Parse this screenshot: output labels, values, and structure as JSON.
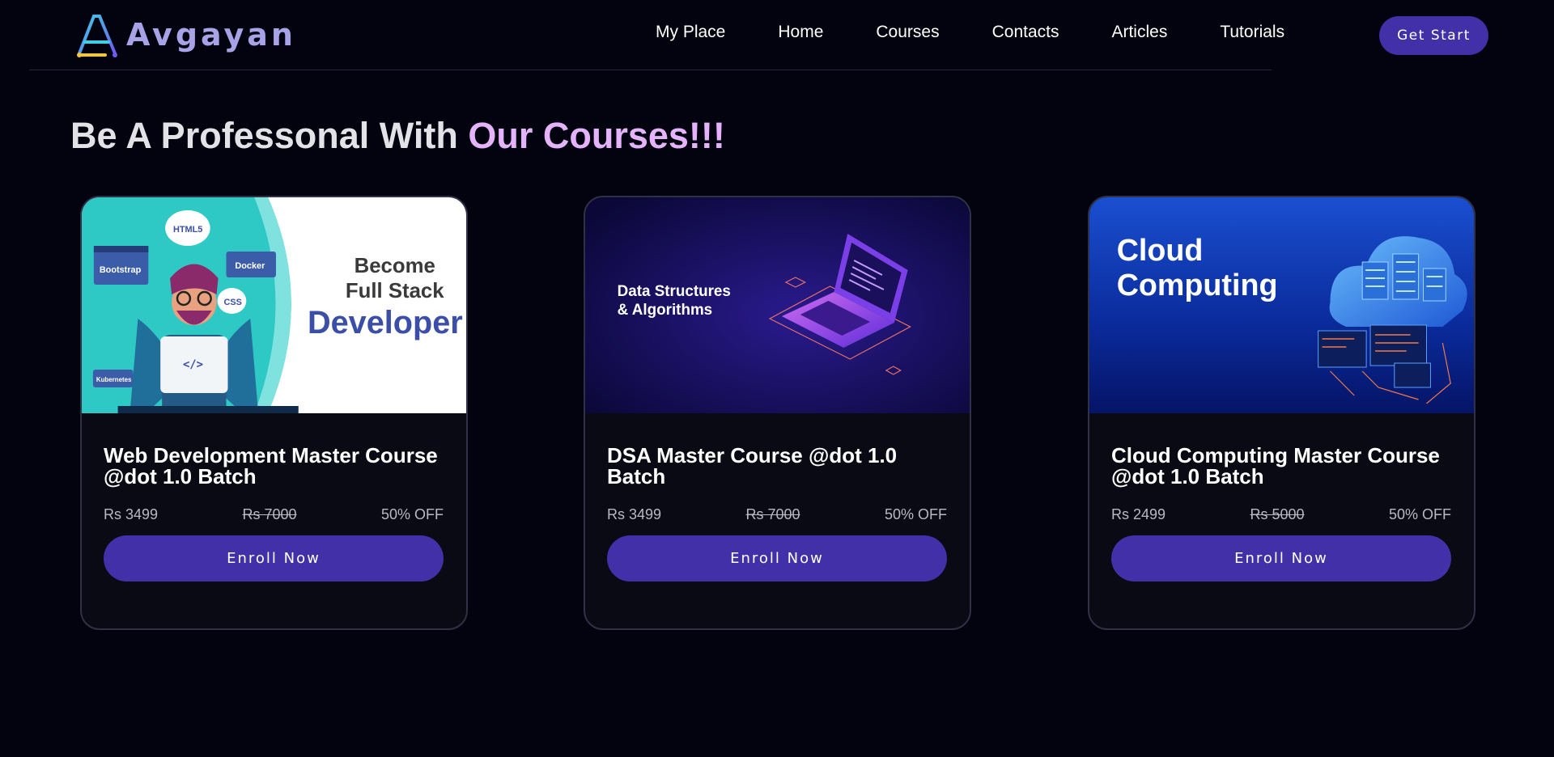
{
  "brand": {
    "name": "Avgayan"
  },
  "nav": {
    "links": [
      "My Place",
      "Home",
      "Courses",
      "Contacts",
      "Articles",
      "Tutorials"
    ],
    "cta_label": "Get Start"
  },
  "hero": {
    "headline_prefix": "Be A Professonal With ",
    "headline_accent": "Our Courses!!!"
  },
  "courses": [
    {
      "title": "Web Development Master Course @dot 1.0 Batch",
      "price": "Rs 3499",
      "original_price": "Rs 7000",
      "discount": "50% OFF",
      "enroll_label": "Enroll Now",
      "banner": {
        "line1": "Become",
        "line2": "Full Stack",
        "line3": "Developer",
        "tags": [
          "HTML5",
          "Bootstrap",
          "Docker",
          "CSS",
          "Kubernetes"
        ],
        "code_symbol": "</>"
      }
    },
    {
      "title": "DSA Master Course @dot 1.0 Batch",
      "price": "Rs 3499",
      "original_price": "Rs 7000",
      "discount": "50% OFF",
      "enroll_label": "Enroll Now",
      "banner": {
        "line1": "Data Structures",
        "line2": "& Algorithms"
      }
    },
    {
      "title": "Cloud Computing Master Course @dot 1.0 Batch",
      "price": "Rs 2499",
      "original_price": "Rs 5000",
      "discount": "50% OFF",
      "enroll_label": "Enroll Now",
      "banner": {
        "line1": "Cloud",
        "line2": "Computing"
      }
    }
  ],
  "colors": {
    "background": "#03030f",
    "accent": "#4130a7",
    "headline_accent": "#e5b3fb",
    "card_border": "#303046"
  },
  "icons": {
    "logo": "a-monogram-logo-icon",
    "code": "code-brackets-icon",
    "laptop": "laptop-icon",
    "cloud": "cloud-server-icon"
  }
}
